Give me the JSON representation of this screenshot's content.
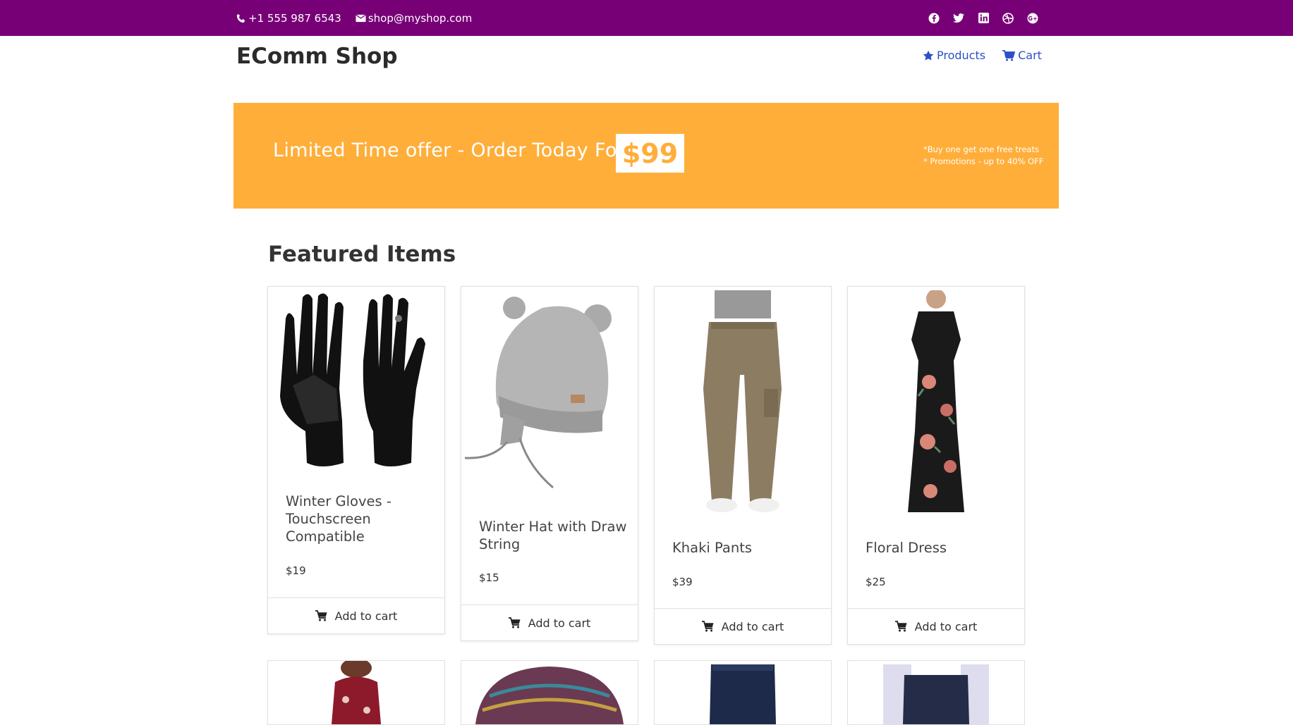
{
  "topbar": {
    "phone": "+1 555 987 6543",
    "email": "shop@myshop.com",
    "social_icons": [
      "facebook-icon",
      "twitter-icon",
      "linkedin-icon",
      "dribbble-icon",
      "google-plus-icon"
    ]
  },
  "header": {
    "brand": "EComm Shop",
    "nav": [
      {
        "label": "Products",
        "icon": "star-icon"
      },
      {
        "label": "Cart",
        "icon": "cart-icon"
      }
    ]
  },
  "banner": {
    "headline": "Limited Time offer - Order Today For",
    "price": "$99",
    "note1": "*Buy one get one free treats",
    "note2": "* Promotions - up to 40% OFF"
  },
  "featured": {
    "title": "Featured Items",
    "add_label": "Add to cart",
    "items": [
      {
        "name": "Winter Gloves - Touchscreen Compatible",
        "price": "$19"
      },
      {
        "name": "Winter Hat with Draw String",
        "price": "$15"
      },
      {
        "name": "Khaki Pants",
        "price": "$39"
      },
      {
        "name": "Floral Dress",
        "price": "$25"
      }
    ]
  },
  "colors": {
    "topbar": "#770077",
    "banner": "#FFAE3A",
    "link": "#2c4fc7"
  }
}
